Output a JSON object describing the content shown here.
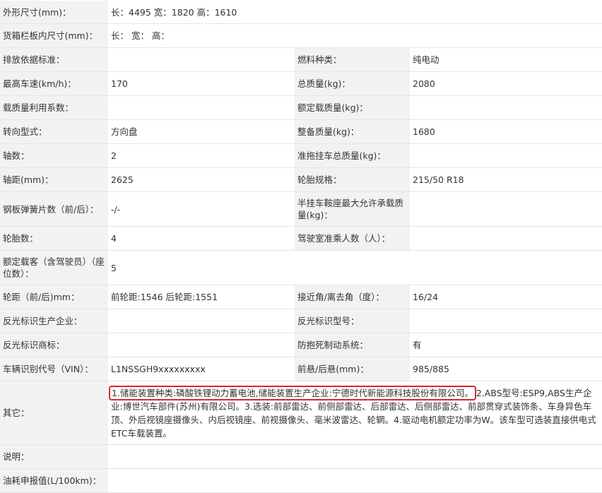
{
  "rows": {
    "dimensions": {
      "label": "外形尺寸(mm)：",
      "value": "长：4495 宽：1820 高：1610"
    },
    "cargo_box": {
      "label": "货箱栏板内尺寸(mm)：",
      "value": "长：  宽：  高："
    },
    "emission": {
      "label": "排放依据标准：",
      "value": "",
      "label2": "燃料种类：",
      "value2": "纯电动"
    },
    "max_speed": {
      "label": "最高车速(km/h)：",
      "value": "170",
      "label2": "总质量(kg)：",
      "value2": "2080"
    },
    "load_coef": {
      "label": "载质量利用系数：",
      "value": "",
      "label2": "额定载质量(kg)：",
      "value2": ""
    },
    "steering": {
      "label": "转向型式：",
      "value": "方向盘",
      "label2": "整备质量(kg)：",
      "value2": "1680"
    },
    "axles": {
      "label": "轴数：",
      "value": "2",
      "label2": "准拖挂车总质量(kg)：",
      "value2": ""
    },
    "wheelbase": {
      "label": "轴距(mm)：",
      "value": "2625",
      "label2": "轮胎规格：",
      "value2": "215/50 R18"
    },
    "leaf_springs": {
      "label": "钢板弹簧片数（前/后）：",
      "value": "-/-",
      "label2": "半挂车鞍座最大允许承载质量(kg)：",
      "value2": ""
    },
    "tire_count": {
      "label": "轮胎数：",
      "value": "4",
      "label2": "驾驶室准乘人数（人）：",
      "value2": ""
    },
    "passengers": {
      "label": "额定载客（含驾驶员）（座位数）：",
      "value": "5"
    },
    "track": {
      "label": "轮距（前/后)mm：",
      "value": "前轮距:1546 后轮距:1551",
      "label2": "接近角/离去角（度）：",
      "value2": "16/24"
    },
    "reflector_maker": {
      "label": "反光标识生产企业：",
      "value": "",
      "label2": "反光标识型号：",
      "value2": ""
    },
    "reflector_brand": {
      "label": "反光标识商标：",
      "value": "",
      "label2": "防抱死制动系统：",
      "value2": "有"
    },
    "vin": {
      "label": "车辆识别代号（VIN）：",
      "value": "L1NSSGH9xxxxxxxxx",
      "label2": "前悬/后悬(mm)：",
      "value2": "985/885"
    },
    "other": {
      "label": "其它：",
      "highlight": "1.储能装置种类:磷酸铁锂动力蓄电池,储能装置生产企业:宁德时代新能源科技股份有限公司。",
      "rest": "2.ABS型号:ESP9,ABS生产企业:博世汽车部件(苏州)有限公司。3.选装:前部雷达、前侧部雷达、后部雷达、后侧部雷达、前部贯穿式装饰条、车身异色车顶、外后视镜座摄像头、内后视镜座、前视摄像头、毫米波雷达、轮辋。4.驱动电机额定功率为W。该车型可选装直接供电式ETC车载装置。"
    },
    "notes": {
      "label": "说明：",
      "value": ""
    },
    "fuel": {
      "label": "油耗申报值(L/100km)：",
      "value": ""
    }
  }
}
